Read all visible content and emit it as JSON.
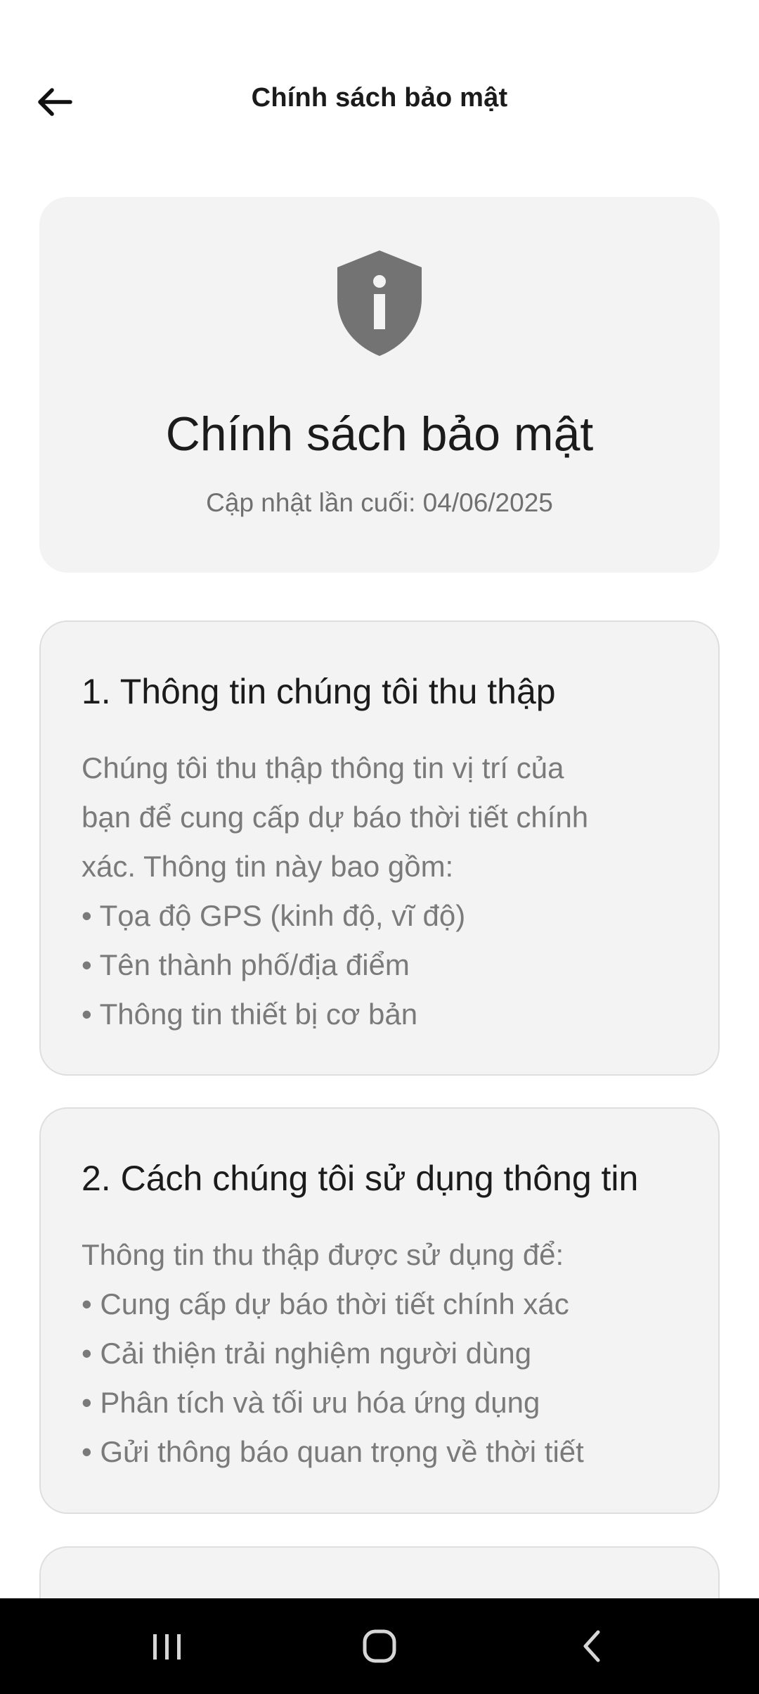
{
  "appbar": {
    "title": "Chính sách bảo mật",
    "back_icon": "arrow-left-icon"
  },
  "hero": {
    "icon": "shield-info-icon",
    "title": "Chính sách bảo mật",
    "updated": "Cập nhật lần cuối: 04/06/2025"
  },
  "sections": [
    {
      "title": "1. Thông tin chúng tôi thu thập",
      "lines": [
        "Chúng tôi thu thập thông tin vị trí của",
        "bạn để cung cấp dự báo thời tiết chính",
        "xác. Thông tin này bao gồm:",
        "• Tọa độ GPS (kinh độ, vĩ độ)",
        "• Tên thành phố/địa điểm",
        "• Thông tin thiết bị cơ bản"
      ]
    },
    {
      "title": "2. Cách chúng tôi sử dụng thông tin",
      "lines": [
        "Thông tin thu thập được sử dụng để:",
        "• Cung cấp dự báo thời tiết chính xác",
        "• Cải thiện trải nghiệm người dùng",
        "• Phân tích và tối ưu hóa ứng dụng",
        "• Gửi thông báo quan trọng về thời tiết"
      ]
    }
  ],
  "navbar": {
    "recents_icon": "recents-icon",
    "home_icon": "home-icon",
    "back_icon": "nav-back-icon"
  },
  "colors": {
    "card_background": "#f3f3f3",
    "card_border": "#dedede",
    "icon_gray": "#737373",
    "body_text": "#7a7a7a",
    "nav_background": "#000000"
  }
}
